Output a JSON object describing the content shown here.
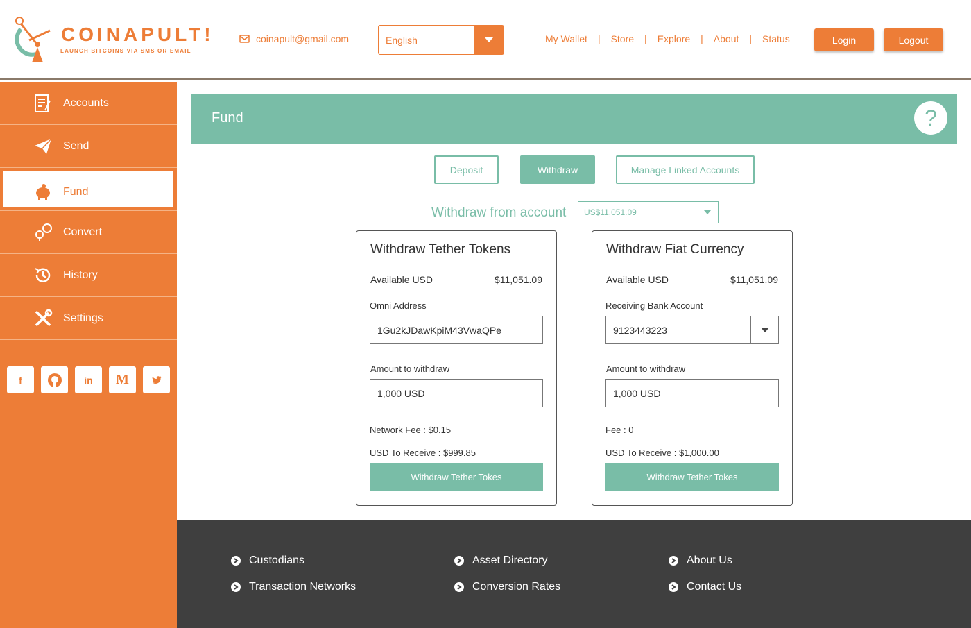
{
  "header": {
    "logo_title": "COINAPULT!",
    "logo_subtitle": "LAUNCH BITCOINS VIA SMS OR EMAIL",
    "email": "coinapult@gmail.com",
    "language": "English",
    "nav": [
      "My Wallet",
      "Store",
      "Explore",
      "About",
      "Status"
    ],
    "nav_separator": "|",
    "login_label": "Login",
    "logout_label": "Logout"
  },
  "sidebar": {
    "items": [
      {
        "label": "Accounts",
        "icon": "accounts-icon"
      },
      {
        "label": "Send",
        "icon": "paper-plane-icon"
      },
      {
        "label": "Fund",
        "icon": "piggy-bank-icon",
        "active": true
      },
      {
        "label": "Convert",
        "icon": "convert-icon"
      },
      {
        "label": "History",
        "icon": "history-icon"
      },
      {
        "label": "Settings",
        "icon": "tools-icon"
      }
    ],
    "socials": [
      "f",
      "github",
      "in",
      "M",
      "twitter"
    ]
  },
  "fund": {
    "title": "Fund",
    "help": "?",
    "tabs": [
      "Deposit",
      "Withdraw",
      "Manage Linked Accounts"
    ],
    "active_tab": "Withdraw",
    "withdraw_from_label": "Withdraw from account",
    "withdraw_from_value": "US$11,051.09"
  },
  "tether": {
    "title": "Withdraw Tether Tokens",
    "available_label": "Available USD",
    "available_value": "$11,051.09",
    "address_label": "Omni Address",
    "address_value": "1Gu2kJDawKpiM43VwaQPe",
    "amount_label": "Amount to withdraw",
    "amount_value": "1,000 USD",
    "fee_text": "Network Fee : $0.15",
    "receive_text": "USD To Receive : $999.85",
    "button": "Withdraw Tether Tokes"
  },
  "fiat": {
    "title": "Withdraw Fiat Currency",
    "available_label": "Available USD",
    "available_value": "$11,051.09",
    "bank_label": "Receiving Bank Account",
    "bank_value": "9123443223",
    "amount_label": "Amount to withdraw",
    "amount_value": "1,000 USD",
    "fee_text": "Fee : 0",
    "receive_text": "USD To Receive : $1,000.00",
    "button": "Withdraw Tether Tokes"
  },
  "footer": {
    "col1": [
      "Custodians",
      "Transaction Networks"
    ],
    "col2": [
      "Asset Directory",
      "Conversion Rates"
    ],
    "col3": [
      "About Us",
      "Contact Us"
    ]
  },
  "colors": {
    "orange": "#ed7d37",
    "teal": "#79bda7",
    "footer": "#3f3f3f"
  }
}
